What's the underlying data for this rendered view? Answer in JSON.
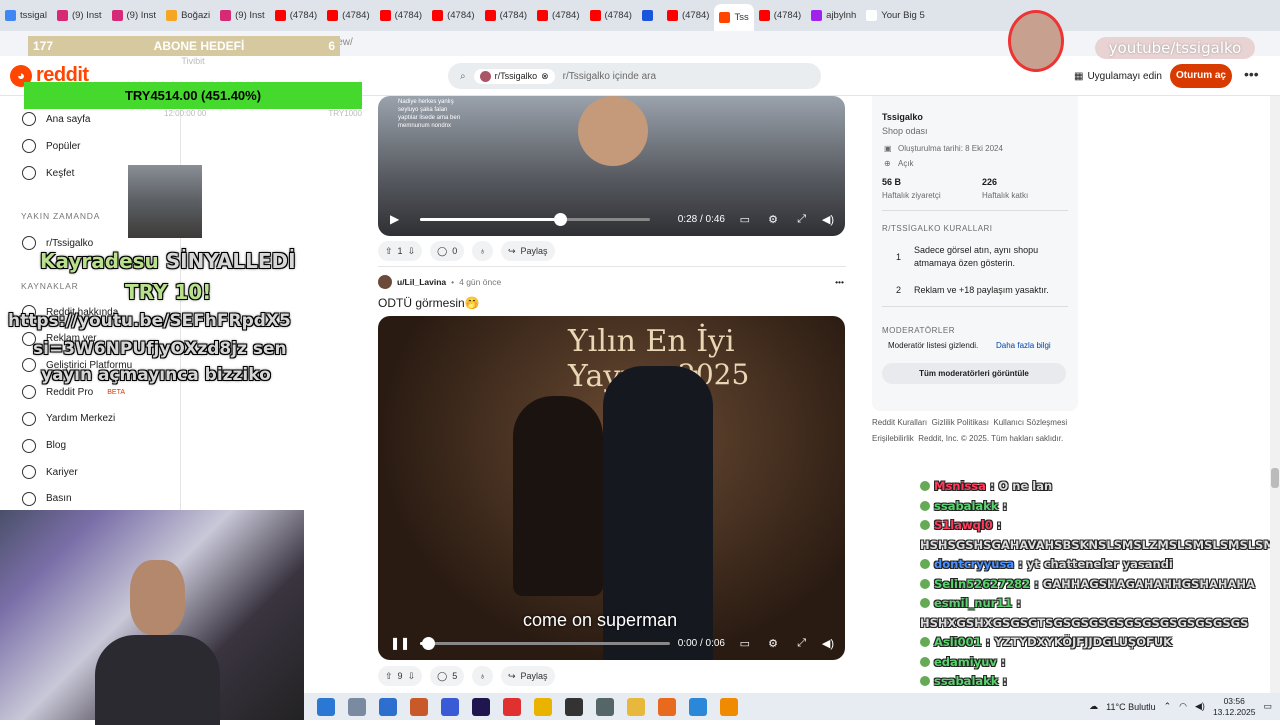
{
  "browser": {
    "tabs": [
      {
        "label": "tssigal",
        "color": "#4285f4"
      },
      {
        "label": "(9) Inst",
        "color": "#d62976"
      },
      {
        "label": "(9) Inst",
        "color": "#d62976"
      },
      {
        "label": "Boğazi",
        "color": "#f5a623"
      },
      {
        "label": "(9) Inst",
        "color": "#d62976"
      },
      {
        "label": "(4784)",
        "color": "#ff0000"
      },
      {
        "label": "(4784)",
        "color": "#ff0000"
      },
      {
        "label": "(4784)",
        "color": "#ff0000"
      },
      {
        "label": "(4784)",
        "color": "#ff0000"
      },
      {
        "label": "(4784)",
        "color": "#ff0000"
      },
      {
        "label": "(4784)",
        "color": "#ff0000"
      },
      {
        "label": "(4784)",
        "color": "#ff0000"
      },
      {
        "label": "",
        "color": "#1a56db"
      },
      {
        "label": "(4784)",
        "color": "#ff0000"
      },
      {
        "label": "Tss",
        "color": "#ff4500",
        "active": true
      },
      {
        "label": "(4784)",
        "color": "#ff0000"
      },
      {
        "label": "ajbylnh",
        "color": "#a020f0"
      },
      {
        "label": "Your Big 5",
        "color": "#ffffff"
      }
    ],
    "url_fragment": "iew/"
  },
  "overlay": {
    "abone_count": "177",
    "abone_label": "ABONE HEDEFİ",
    "abone_goal": "6",
    "try_header": "Tivibit",
    "try_value": "TRY4514.00 (451.40%)",
    "chart_left": "12:00:00 00",
    "chart_right": "TRY1000",
    "kay_a": "Kayradesu",
    "kay_b": " SİNYALLEDİ",
    "try10": "TRY 10!",
    "link1": "https://youtu.be/SEFhFRpdX5",
    "link2": "si=3W6NPUfjyOXzd8jz sen",
    "link3": "yayın açmayınca bizziko",
    "yt_handle": "youtube/tssigalko"
  },
  "reddit": {
    "logo": "reddit",
    "search_chip": "r/Tssigalko",
    "search_placeholder": "r/Tssigalko içinde ara",
    "get_app": "Uygulamayı edin",
    "login": "Oturum aç"
  },
  "sidebar": {
    "items": [
      {
        "label": "Ana sayfa",
        "icon": "home-icon"
      },
      {
        "label": "Popüler",
        "icon": "popular-icon"
      },
      {
        "label": "Keşfet",
        "icon": "explore-icon"
      }
    ],
    "recent_head": "YAKIN ZAMANDA",
    "recent": [
      {
        "label": "r/Tssigalko"
      }
    ],
    "resources_head": "KAYNAKLAR",
    "resources": [
      {
        "label": "Reddit hakkında"
      },
      {
        "label": "Reklam ver"
      },
      {
        "label": "Geliştirici Platformu"
      },
      {
        "label": "Reddit Pro",
        "badge": "BETA"
      },
      {
        "label": "Yardım Merkezi"
      },
      {
        "label": "Blog"
      },
      {
        "label": "Kariyer"
      },
      {
        "label": "Basın"
      }
    ]
  },
  "posts": [
    {
      "video_time": "0:28 / 0:46",
      "progress": 0.61,
      "votes": "1",
      "comments": "0",
      "share": "Paylaş",
      "caption": "Nadiye herkes yanlış seyluyo şaka falan yaptılar lisede ama ben memnunum nondnx"
    },
    {
      "author": "u/Lil_Lavina",
      "age": "4 gün önce",
      "title": "ODTÜ görmesin🤭",
      "video_title_1": "Yılın En İyi Yayıncısı",
      "video_title_2": "2025",
      "subtitle": "come on superman",
      "video_time": "0:00 / 0:06",
      "progress": 0.03,
      "votes": "9",
      "comments": "5",
      "share": "Paylaş"
    }
  ],
  "community": {
    "name": "Tssigalko",
    "subtitle": "Shop odası",
    "created": "Oluşturulma tarihi: 8 Eki 2024",
    "visibility": "Açık",
    "visitors": "56 B",
    "visitors_label": "Haftalık ziyaretçi",
    "contributions": "226",
    "contributions_label": "Haftalık katkı",
    "rules_head": "R/TSSİGALKO KURALLARI",
    "rules": [
      {
        "n": "1",
        "text": "Sadece görsel atın, aynı shopu atmamaya özen gösterin."
      },
      {
        "n": "2",
        "text": "Reklam ve +18 paylaşım yasaktır."
      }
    ],
    "mods_head": "MODERATÖRLER",
    "mods_hidden": "Moderatör listesi gizlendi.",
    "mods_more": "Daha fazla bilgi",
    "mods_button": "Tüm moderatörleri görüntüle",
    "footer_links": [
      "Reddit Kuralları",
      "Gizlilik Politikası",
      "Kullanıcı Sözleşmesi",
      "Erişilebilirlik"
    ],
    "copyright": "Reddit, Inc. © 2025. Tüm hakları saklıdır."
  },
  "chat": [
    {
      "user": "Msnissa",
      "msg": ": O ne lan",
      "color": "#ff3b5c"
    },
    {
      "user": "ssabalakk",
      "msg": ":",
      "color": "#59d36d"
    },
    {
      "user": "S1lawql0",
      "msg": ":",
      "color": "#ff3b5c"
    },
    {
      "user": "",
      "msg": "HSHSGSHSGAHAVAHSBSKNSLSMSLZMSLSMSLSMSLSMÖSMD",
      "color": "#ddd"
    },
    {
      "user": "dontcryyusa",
      "msg": ": yt chatteneler yasandi",
      "color": "#4a90ff"
    },
    {
      "user": "Selin52627282",
      "msg": ": GAHHAGSHAGAHAHHGSHAHAHA",
      "color": "#59d36d"
    },
    {
      "user": "esmil_nur11",
      "msg": ":",
      "color": "#59d36d"
    },
    {
      "user": "",
      "msg": "HSHXGSHXGSGSGTSGSGSGSGSGSGSGSGSGSGSGS",
      "color": "#ddd"
    },
    {
      "user": "Asli001",
      "msg": ": YZTYDXYKÖJFJJDGLUŞOFUK",
      "color": "#59d36d"
    },
    {
      "user": "edamiyuv",
      "msg": ":",
      "color": "#59d36d"
    },
    {
      "user": "ssabalakk",
      "msg": ":",
      "color": "#59d36d"
    },
    {
      "user": "ssabalakk",
      "msg": "",
      "color": "#59d36d"
    }
  ],
  "taskbar": {
    "weather": "11°C  Bulutlu",
    "time": "03:56",
    "date": "13.12.2025"
  }
}
